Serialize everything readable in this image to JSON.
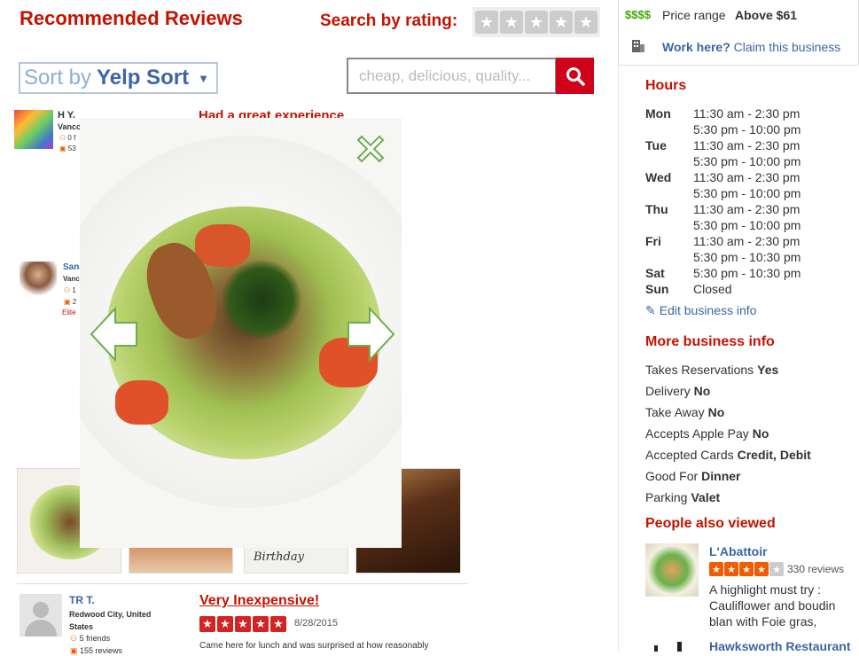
{
  "header": {
    "title": "Recommended Reviews",
    "search_by_rating_label": "Search by rating:",
    "sort_prefix": "Sort by",
    "sort_value": "Yelp Sort",
    "search_placeholder": "cheap, delicious, quality..."
  },
  "business_top": {
    "price_symbol": "$$$$",
    "price_label": "Price range",
    "price_value": "Above $61",
    "work_here": "Work here?",
    "claim": "Claim this business"
  },
  "hours": {
    "title": "Hours",
    "rows": [
      {
        "day": "Mon",
        "time": "11:30 am - 2:30 pm"
      },
      {
        "day": "",
        "time": "5:30 pm - 10:00 pm"
      },
      {
        "day": "Tue",
        "time": "11:30 am - 2:30 pm"
      },
      {
        "day": "",
        "time": "5:30 pm - 10:00 pm"
      },
      {
        "day": "Wed",
        "time": "11:30 am - 2:30 pm"
      },
      {
        "day": "",
        "time": "5:30 pm - 10:00 pm"
      },
      {
        "day": "Thu",
        "time": "11:30 am - 2:30 pm"
      },
      {
        "day": "",
        "time": "5:30 pm - 10:00 pm"
      },
      {
        "day": "Fri",
        "time": "11:30 am - 2:30 pm"
      },
      {
        "day": "",
        "time": "5:30 pm - 10:30 pm"
      },
      {
        "day": "Sat",
        "time": "5:30 pm - 10:30 pm"
      },
      {
        "day": "Sun",
        "time": "Closed"
      }
    ],
    "edit_link": "Edit business info"
  },
  "more_info": {
    "title": "More business info",
    "rows": [
      {
        "label": "Takes Reservations",
        "value": "Yes"
      },
      {
        "label": "Delivery",
        "value": "No"
      },
      {
        "label": "Take Away",
        "value": "No"
      },
      {
        "label": "Accepts Apple Pay",
        "value": "No"
      },
      {
        "label": "Accepted Cards",
        "value": "Credit, Debit"
      },
      {
        "label": "Good For",
        "value": "Dinner"
      },
      {
        "label": "Parking",
        "value": "Valet"
      }
    ]
  },
  "people_also_viewed": {
    "title": "People also viewed",
    "items": [
      {
        "name": "L'Abattoir",
        "reviews": "330 reviews",
        "rating": 4,
        "snippet": "A highlight must try : Cauliflower and boudin blan with Foie gras, parsley, lem"
      },
      {
        "name": "Hawksworth Restaurant",
        "reviews": "",
        "rating": 0,
        "snippet": ""
      }
    ]
  },
  "reviews": [
    {
      "name": "H Y.",
      "location": "Vanco",
      "friends": "0 f",
      "count": "53",
      "title": "Had a great experience"
    },
    {
      "name": "Sana",
      "location": "Vanc",
      "friends": "1",
      "count": "2",
      "elite": "Elite"
    }
  ],
  "review_bottom": {
    "name": "TR T.",
    "location": "Redwood City, United States",
    "friends": "5 friends",
    "count": "155 reviews",
    "title": "Very Inexpensive!",
    "date": "8/28/2015",
    "rating": 5,
    "text": "Came here for lunch and was surprised at how reasonably"
  },
  "thumb_text": "Birthday",
  "colors": {
    "brand_red": "#c41200",
    "link_blue": "#3b65a7",
    "star_orange": "#f15c00",
    "price_green": "#41a700",
    "lightbox_green": "#6cae4f"
  }
}
